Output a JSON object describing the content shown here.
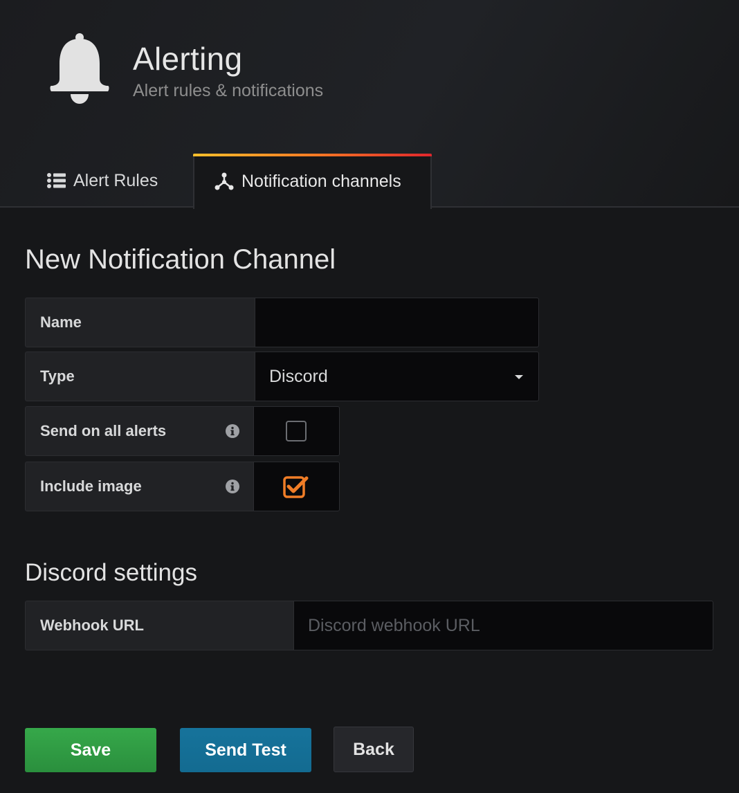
{
  "header": {
    "title": "Alerting",
    "subtitle": "Alert rules & notifications",
    "icon": "bell-icon"
  },
  "tabs": [
    {
      "label": "Alert Rules",
      "icon": "list-icon",
      "active": false
    },
    {
      "label": "Notification channels",
      "icon": "nodes-icon",
      "active": true
    }
  ],
  "form": {
    "title": "New Notification Channel",
    "name": {
      "label": "Name",
      "value": ""
    },
    "type": {
      "label": "Type",
      "value": "Discord"
    },
    "send_on_all_alerts": {
      "label": "Send on all alerts",
      "checked": false
    },
    "include_image": {
      "label": "Include image",
      "checked": true
    }
  },
  "discord": {
    "title": "Discord settings",
    "webhook": {
      "label": "Webhook URL",
      "value": "",
      "placeholder": "Discord webhook URL"
    }
  },
  "buttons": {
    "save": "Save",
    "send_test": "Send Test",
    "back": "Back"
  },
  "colors": {
    "background": "#161719",
    "save": "#2f9a43",
    "send_test": "#156f96",
    "checkbox_accent": "#f07d27",
    "tab_gradient": [
      "#fbbf2b",
      "#f77c24",
      "#e0262c"
    ]
  }
}
